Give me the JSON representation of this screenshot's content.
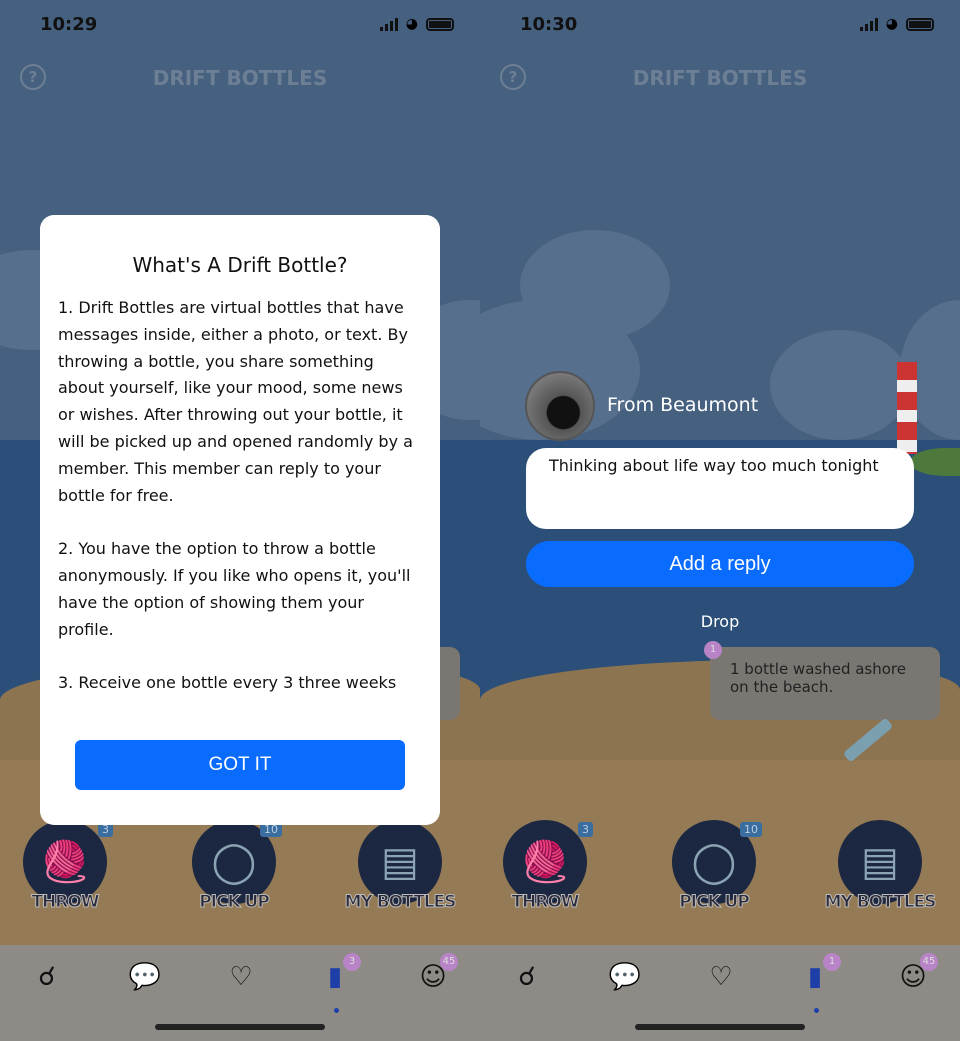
{
  "screens": [
    {
      "status": {
        "time": "10:29"
      },
      "header": {
        "title": "DRIFT BOTTLES",
        "help_icon": "question-circle-icon"
      },
      "modal": {
        "title": "What's A Drift Bottle?",
        "body": "1. Drift Bottles are virtual bottles that have messages inside, either a photo, or text. By throwing a bottle, you share something about yourself, like your mood, some news or wishes. After throwing out your bottle, it will be picked up and opened randomly by a member. This member can reply to your bottle for free.\n\n2. You have the option to throw a bottle anonymously. If you like who opens it, you'll have the option of showing them your profile.\n\n3. Receive one bottle every 3 three weeks",
        "button": "GOT IT"
      }
    },
    {
      "status": {
        "time": "10:30"
      },
      "header": {
        "title": "DRIFT BOTTLES"
      },
      "bottle_card": {
        "from": "From Beaumont",
        "message": "Thinking about life way too much tonight",
        "reply_button": "Add a reply"
      },
      "drop_label": "Drop",
      "notice": {
        "badge": "1",
        "text": "1 bottle washed ashore on the beach."
      }
    }
  ],
  "actions": [
    {
      "label": "THROW",
      "badge": "3",
      "icon": "bottle-icon"
    },
    {
      "label": "PICK UP",
      "badge": "10",
      "icon": "net-icon"
    },
    {
      "label": "MY BOTTLES",
      "icon": "bottle-crate-icon"
    }
  ],
  "tabbar": {
    "items": [
      "search-icon",
      "chat-icon",
      "heart-icon",
      "bottle-icon",
      "profile-icon"
    ],
    "badges_left": {
      "bottles": "3",
      "profile": "45"
    },
    "badges_right": {
      "bottles": "1",
      "profile": "45"
    },
    "active": "bottles"
  },
  "colors": {
    "accent": "#0a6cff",
    "badge": "#b883c7"
  }
}
